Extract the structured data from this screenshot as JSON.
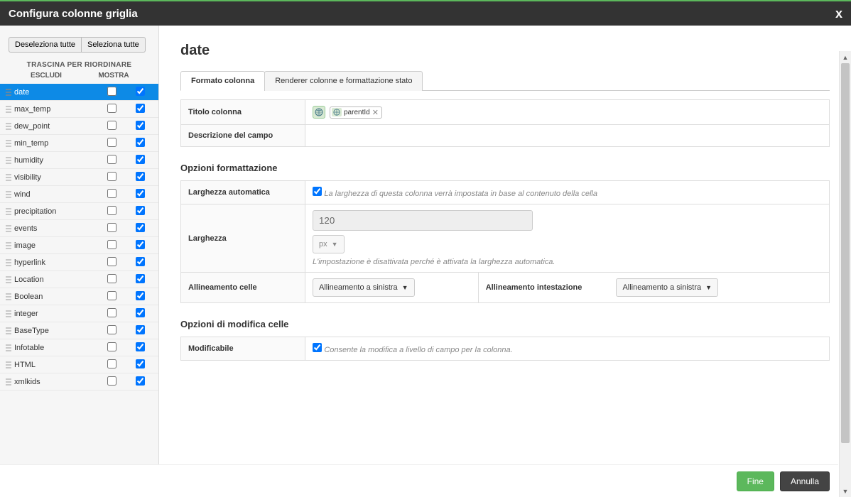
{
  "header": {
    "title": "Configura colonne griglia",
    "close": "x"
  },
  "left": {
    "deselect_all": "Deseleziona tutte",
    "select_all": "Seleziona tutte",
    "drag_label": "TRASCINA PER RIORDINARE",
    "col_exclude": "ESCLUDI",
    "col_show": "MOSTRA",
    "fields": [
      {
        "name": "date",
        "exclude": false,
        "show": true,
        "selected": true
      },
      {
        "name": "max_temp",
        "exclude": false,
        "show": true
      },
      {
        "name": "dew_point",
        "exclude": false,
        "show": true
      },
      {
        "name": "min_temp",
        "exclude": false,
        "show": true
      },
      {
        "name": "humidity",
        "exclude": false,
        "show": true
      },
      {
        "name": "visibility",
        "exclude": false,
        "show": true
      },
      {
        "name": "wind",
        "exclude": false,
        "show": true
      },
      {
        "name": "precipitation",
        "exclude": false,
        "show": true
      },
      {
        "name": "events",
        "exclude": false,
        "show": true
      },
      {
        "name": "image",
        "exclude": false,
        "show": true
      },
      {
        "name": "hyperlink",
        "exclude": false,
        "show": true
      },
      {
        "name": "Location",
        "exclude": false,
        "show": true
      },
      {
        "name": "Boolean",
        "exclude": false,
        "show": true
      },
      {
        "name": "integer",
        "exclude": false,
        "show": true
      },
      {
        "name": "BaseType",
        "exclude": false,
        "show": true
      },
      {
        "name": "Infotable",
        "exclude": false,
        "show": true
      },
      {
        "name": "HTML",
        "exclude": false,
        "show": true
      },
      {
        "name": "xmlkids",
        "exclude": false,
        "show": true
      }
    ]
  },
  "right": {
    "title": "date",
    "tabs": {
      "format": "Formato colonna",
      "renderer": "Renderer colonne e formattazione stato"
    },
    "column_title_label": "Titolo colonna",
    "column_title_chip": "parentId",
    "field_desc_label": "Descrizione del campo",
    "format_options": "Opzioni formattazione",
    "auto_width_label": "Larghezza automatica",
    "auto_width_desc": "La larghezza di questa colonna verrà impostata in base al contenuto della cella",
    "auto_width_checked": true,
    "width_label": "Larghezza",
    "width_value": "120",
    "width_unit": "px",
    "width_note": "L'impostazione è disattivata perché è attivata la larghezza automatica.",
    "cell_align_label": "Allineamento celle",
    "cell_align_value": "Allineamento a sinistra",
    "header_align_label": "Allineamento intestazione",
    "header_align_value": "Allineamento a sinistra",
    "edit_options": "Opzioni di modifica celle",
    "editable_label": "Modificabile",
    "editable_checked": true,
    "editable_desc": "Consente la modifica a livello di campo per la colonna."
  },
  "footer": {
    "done": "Fine",
    "cancel": "Annulla"
  }
}
